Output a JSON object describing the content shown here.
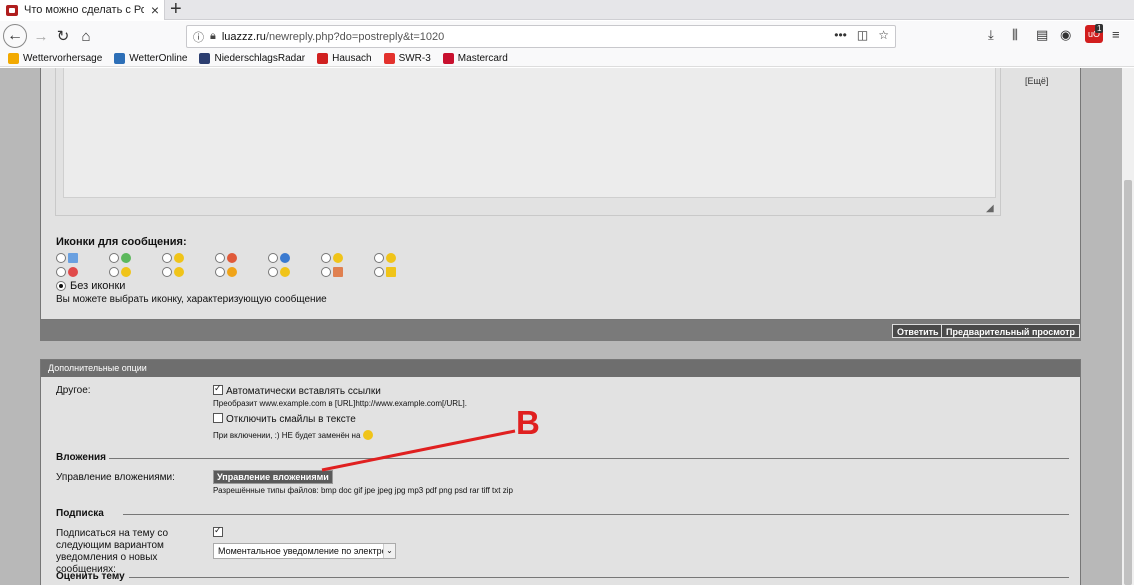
{
  "browser": {
    "tab_title": "Что можно сделать с Родным",
    "url_domain": "luazzz.ru",
    "url_path": "/newreply.php?do=postreply&t=1020",
    "badge_count": "1",
    "bookmarks": [
      {
        "label": "Wettervorhersage",
        "color": "#f2a900"
      },
      {
        "label": "WetterOnline",
        "color": "#2d6fb7"
      },
      {
        "label": "NiederschlagsRadar",
        "color": "#2c3e70"
      },
      {
        "label": "Hausach",
        "color": "#d02020"
      },
      {
        "label": "SWR-3",
        "color": "#e3312d"
      },
      {
        "label": "Mastercard",
        "color": "#c8102e"
      }
    ]
  },
  "editor": {
    "more_link": "[Ещё]"
  },
  "message_icons": {
    "title": "Иконки для сообщения:",
    "none_label": "Без иконки",
    "hint": "Вы можете выбрать иконку, характеризующую сообщение",
    "row1": [
      "#6aa0e0",
      "#5cb85c",
      "#f0c419",
      "#e05a3a",
      "#3a7ad0",
      "#f0c419",
      "#f0c419"
    ],
    "row2": [
      "#e04a4a",
      "#f0c419",
      "#f0c419",
      "#f0a419",
      "#f0c419",
      "#e08050",
      "#f0c419"
    ]
  },
  "submit_bar": {
    "reply_label": "Ответить",
    "preview_label": "Предварительный просмотр"
  },
  "options": {
    "header": "Дополнительные опции",
    "other_label": "Другое:",
    "auto_links_label": "Автоматически вставлять ссылки",
    "auto_links_checked": true,
    "auto_links_hint": "Преобразит www.example.com в [URL]http://www.example.com[/URL].",
    "disable_smilies_label": "Отключить смайлы в тексте",
    "disable_smilies_checked": false,
    "disable_smilies_hint": "При включении, :) НЕ будет заменён на",
    "attachments_section": "Вложения",
    "attachments_manage_label": "Управление вложениями:",
    "attachments_button": "Управление вложениями",
    "attachments_allowed": "Разрешённые типы файлов: bmp doc gif jpe jpeg jpg mp3 pdf png psd rar tiff txt zip",
    "subscription_section": "Подписка",
    "subscribe_label": "Подписаться на тему со следующим вариантом уведомления о новых сообщениях:",
    "subscribe_checked": true,
    "notify_selected": "Моментальное уведомление по электронн",
    "rate_section": "Оценить тему"
  },
  "annotation": {
    "letter": "B",
    "color": "#e02020"
  }
}
